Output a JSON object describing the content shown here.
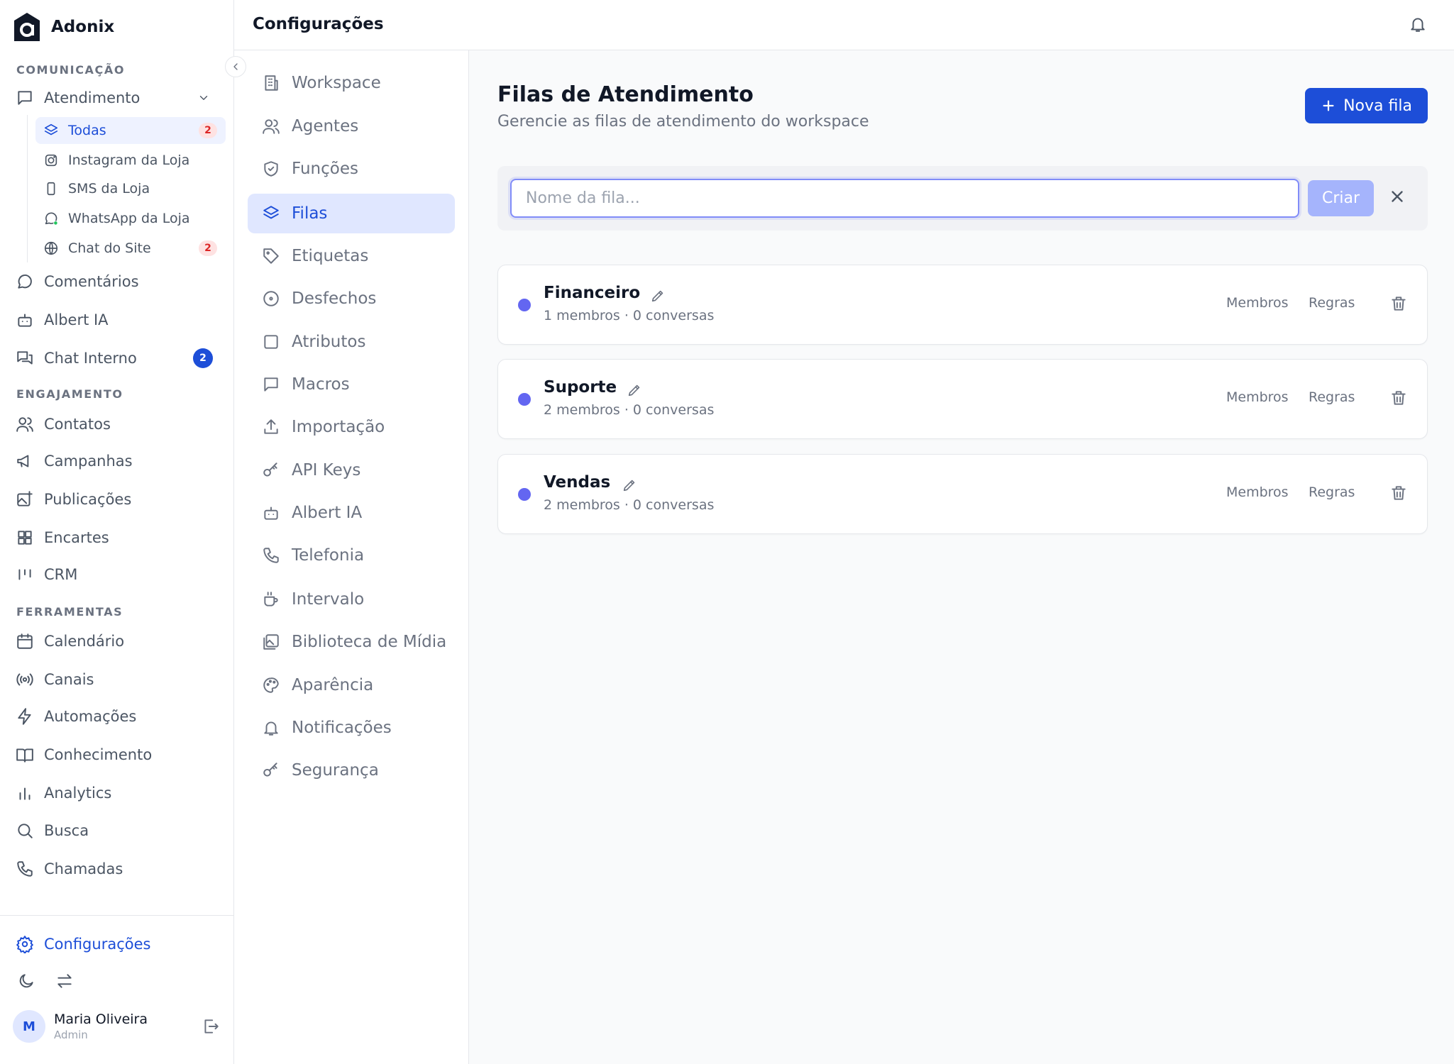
{
  "app": {
    "name": "Adonix"
  },
  "header": {
    "title": "Configurações"
  },
  "sidebar": {
    "sections": {
      "comunicacao": "COMUNICAÇÃO",
      "engajamento": "ENGAJAMENTO",
      "ferramentas": "FERRAMENTAS"
    },
    "atendimento": {
      "label": "Atendimento",
      "children": [
        {
          "label": "Todas",
          "badge": "2",
          "icon": "layers-icon"
        },
        {
          "label": "Instagram da Loja",
          "icon": "instagram-icon"
        },
        {
          "label": "SMS da Loja",
          "icon": "phone-device-icon"
        },
        {
          "label": "WhatsApp da Loja",
          "icon": "whatsapp-icon"
        },
        {
          "label": "Chat do Site",
          "badge": "2",
          "icon": "globe-icon"
        }
      ]
    },
    "items": {
      "comentarios": "Comentários",
      "albert_ia": "Albert IA",
      "chat_interno": "Chat Interno",
      "chat_interno_badge": "2",
      "contatos": "Contatos",
      "campanhas": "Campanhas",
      "publicacoes": "Publicações",
      "encartes": "Encartes",
      "crm": "CRM",
      "calendario": "Calendário",
      "canais": "Canais",
      "automacoes": "Automações",
      "conhecimento": "Conhecimento",
      "analytics": "Analytics",
      "busca": "Busca",
      "chamadas": "Chamadas",
      "configuracoes": "Configurações"
    },
    "user": {
      "initial": "M",
      "name": "Maria Oliveira",
      "role": "Admin"
    }
  },
  "settings_nav": [
    "Workspace",
    "Agentes",
    "Funções",
    "Filas",
    "Etiquetas",
    "Desfechos",
    "Atributos",
    "Macros",
    "Importação",
    "API Keys",
    "Albert IA",
    "Telefonia",
    "Intervalo",
    "Biblioteca de Mídia",
    "Aparência",
    "Notificações",
    "Segurança"
  ],
  "main": {
    "title": "Filas de Atendimento",
    "subtitle": "Gerencie as filas de atendimento do workspace",
    "new_button": "Nova fila",
    "create_form": {
      "placeholder": "Nome da fila...",
      "value": "",
      "submit": "Criar"
    },
    "queues": [
      {
        "name": "Financeiro",
        "meta": "1 membros · 0 conversas",
        "members_label": "Membros",
        "rules_label": "Regras",
        "color": "#6366f1"
      },
      {
        "name": "Suporte",
        "meta": "2 membros · 0 conversas",
        "members_label": "Membros",
        "rules_label": "Regras",
        "color": "#6366f1"
      },
      {
        "name": "Vendas",
        "meta": "2 membros · 0 conversas",
        "members_label": "Membros",
        "rules_label": "Regras",
        "color": "#6366f1"
      }
    ]
  },
  "colors": {
    "accent": "#1d4ed8",
    "accent_soft": "#e0e7ff",
    "badge_red": "#dc2626",
    "queue_dot": "#6366f1"
  }
}
